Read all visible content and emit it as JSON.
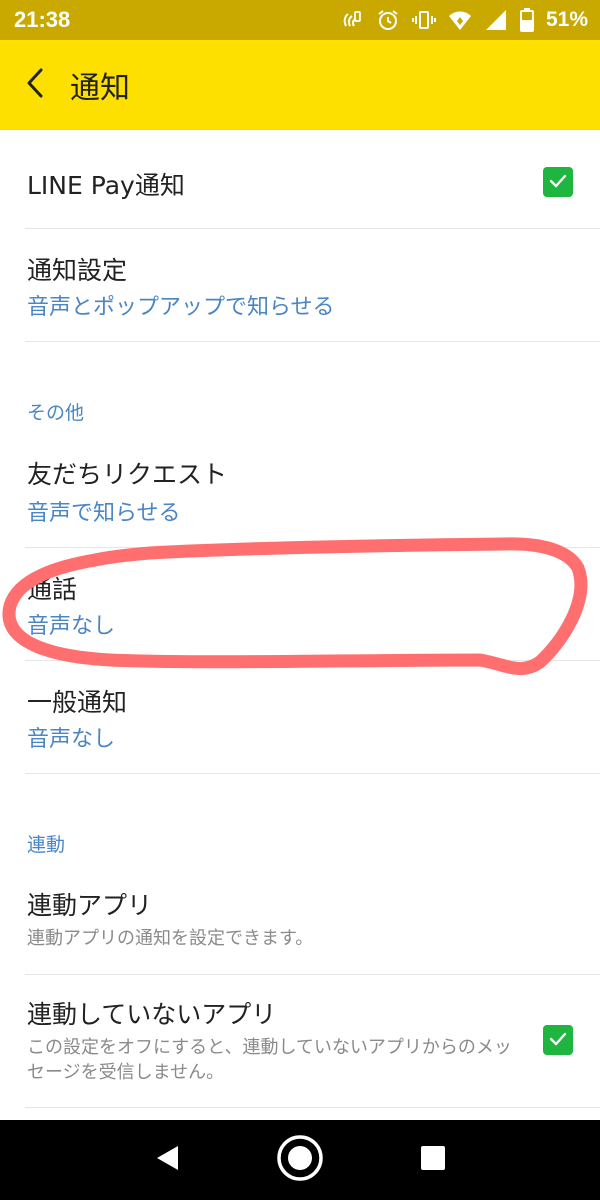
{
  "status_bar": {
    "time": "21:38",
    "battery": "51%",
    "icons": [
      "nfc-icon",
      "alarm-icon",
      "vibrate-icon",
      "wifi-icon",
      "signal-icon",
      "battery-icon"
    ]
  },
  "app_bar": {
    "title": "通知",
    "back_icon": "chevron-left-icon"
  },
  "settings": {
    "line_pay": {
      "title": "LINE Pay通知",
      "checked": true
    },
    "notification_settings": {
      "title": "通知設定",
      "value": "音声とポップアップで知らせる"
    },
    "other_header": "その他",
    "friend_request": {
      "title": "友だちリクエスト",
      "value": "音声で知らせる"
    },
    "call": {
      "title": "通話",
      "value": "音声なし"
    },
    "general": {
      "title": "一般通知",
      "value": "音声なし"
    },
    "linked_header": "連動",
    "linked_apps": {
      "title": "連動アプリ",
      "desc": "連動アプリの通知を設定できます。"
    },
    "unlinked_apps": {
      "title": "連動していないアプリ",
      "desc": "この設定をオフにすると、連動していないアプリからのメッセージを受信しません。",
      "checked": true
    }
  },
  "colors": {
    "status_bar": "#c9a900",
    "app_bar": "#fde000",
    "accent_text": "#4a86c6",
    "checkbox": "#1fb640",
    "annotation": "#ff6f6f"
  },
  "nav_bar": {
    "buttons": [
      "back-triangle-icon",
      "home-circle-icon",
      "recents-square-icon"
    ]
  }
}
